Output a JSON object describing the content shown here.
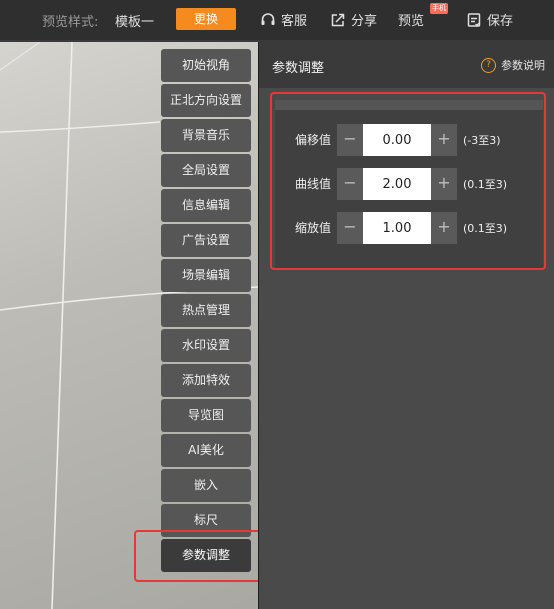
{
  "topbar": {
    "template_label": "预览样式:",
    "template_value": "模板一",
    "change_button": "更换",
    "items": {
      "service": "客服",
      "share": "分享",
      "preview": "预览",
      "preview_badge": "手机",
      "save": "保存"
    }
  },
  "menu": {
    "items": [
      {
        "label": "初始视角"
      },
      {
        "label": "正北方向设置"
      },
      {
        "label": "背景音乐"
      },
      {
        "label": "全局设置"
      },
      {
        "label": "信息编辑"
      },
      {
        "label": "广告设置"
      },
      {
        "label": "场景编辑"
      },
      {
        "label": "热点管理"
      },
      {
        "label": "水印设置"
      },
      {
        "label": "添加特效"
      },
      {
        "label": "导览图"
      },
      {
        "label": "AI美化"
      },
      {
        "label": "嵌入"
      },
      {
        "label": "标尺"
      },
      {
        "label": "参数调整"
      }
    ],
    "active_index": 14
  },
  "panel": {
    "title": "参数调整",
    "help_label": "参数说明",
    "params": [
      {
        "label": "偏移值",
        "value": "0.00",
        "range": "(-3至3)"
      },
      {
        "label": "曲线值",
        "value": "2.00",
        "range": "(0.1至3)"
      },
      {
        "label": "缩放值",
        "value": "1.00",
        "range": "(0.1至3)"
      }
    ],
    "minus_symbol": "−",
    "plus_symbol": "+"
  },
  "colors": {
    "accent": "#f58a1f",
    "highlight": "#e53935",
    "panel_bg": "#4a4a4a"
  }
}
